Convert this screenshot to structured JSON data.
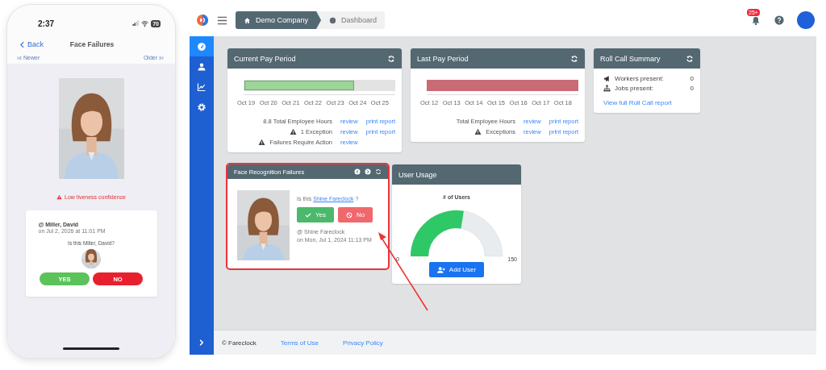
{
  "phone": {
    "time": "2:37",
    "battery": "70",
    "back": "Back",
    "title": "Face Failures",
    "newer": "Newer",
    "older": "Older",
    "warning": "Low liveness confidence",
    "card": {
      "name": "@ Miller, David",
      "date": "on Jul 2, 2026 at 11:01 PM",
      "question": "Is this Miller, David?",
      "buttons": [
        {
          "kind": "yes",
          "label": "YES"
        },
        {
          "kind": "no",
          "label": "NO"
        }
      ]
    }
  },
  "topbar": {
    "breadcrumb": [
      {
        "label": "Demo Company",
        "selected": true
      },
      {
        "label": "Dashboard",
        "selected": false
      }
    ],
    "notification_badge": "25+"
  },
  "sidebar": {
    "items": [
      {
        "kind": "dashboard",
        "selected": true
      },
      {
        "kind": "users",
        "selected": false
      },
      {
        "kind": "reports",
        "selected": false
      },
      {
        "kind": "settings",
        "selected": false
      }
    ]
  },
  "current_pay_period": {
    "title": "Current Pay Period",
    "level": 0.73,
    "color": "#9dd49a",
    "dates": [
      "Oct 19",
      "Oct 20",
      "Oct 21",
      "Oct 22",
      "Oct 23",
      "Oct 24",
      "Oct 25"
    ],
    "rows": [
      {
        "kind": "plain",
        "label": "8.8 Total Employee Hours",
        "links": [
          "review",
          "print report"
        ]
      },
      {
        "kind": "warning",
        "label": "1 Exception",
        "links": [
          "review",
          "print report"
        ]
      },
      {
        "kind": "warning",
        "label": "Failures Require Action",
        "links": [
          "review"
        ]
      }
    ]
  },
  "last_pay_period": {
    "title": "Last Pay Period",
    "color": "#c96b75",
    "dates": [
      "Oct 12",
      "Oct 13",
      "Oct 14",
      "Oct 15",
      "Oct 16",
      "Oct 17",
      "Oct 18"
    ],
    "rows": [
      {
        "kind": "plain",
        "label": "Total Employee Hours",
        "links": [
          "review",
          "print report"
        ]
      },
      {
        "kind": "warning",
        "label": "Exceptions",
        "links": [
          "review",
          "print report"
        ]
      }
    ]
  },
  "roll_call": {
    "title": "Roll Call Summary",
    "rows": [
      {
        "kind": "megaphone",
        "label": "Workers present:",
        "value": "0"
      },
      {
        "kind": "sitemap",
        "label": "Jobs present:",
        "value": "0"
      }
    ],
    "link": "View full Roll Call report"
  },
  "face_failures": {
    "title": "Face Recognition Failures",
    "highlighted": true,
    "question_prefix": "Is this",
    "question_link": "Shine Fareclock",
    "question_suffix": "?",
    "buttons": [
      {
        "kind": "yes",
        "label": "Yes"
      },
      {
        "kind": "no",
        "label": "No"
      }
    ],
    "by": "@ Shine Fareclock",
    "date": "on Mon, Jul 1, 2024 11:13 PM"
  },
  "user_usage": {
    "title": "User Usage",
    "gauge_title": "# of Users",
    "level": 0.55,
    "min": "0",
    "max": "150",
    "button": "Add User"
  },
  "footer": {
    "copyright": "© Fareclock",
    "links": [
      "Terms of Use",
      "Privacy Policy"
    ]
  }
}
